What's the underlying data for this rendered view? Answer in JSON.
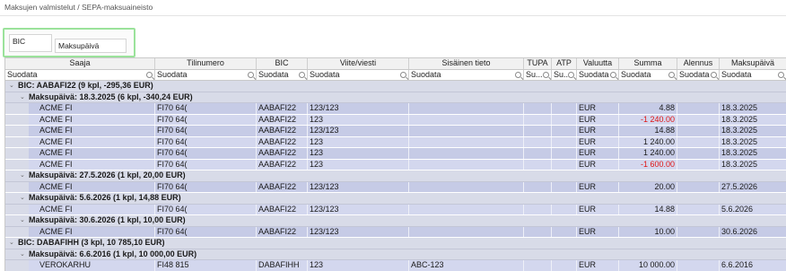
{
  "breadcrumb": "Maksujen valmistelut / SEPA-maksuaineisto",
  "grouping": {
    "chips": [
      "BIC",
      "Maksupäivä"
    ]
  },
  "columns": [
    "Saaja",
    "Tilinumero",
    "BIC",
    "Viite/viesti",
    "Sisäinen tieto",
    "TUPA",
    "ATP",
    "Valuutta",
    "Summa",
    "Alennus",
    "Maksupäivä"
  ],
  "filters": [
    "Suodata",
    "Suodata",
    "Suodata",
    "Suodata",
    "Suodata",
    "Su...",
    "Su...",
    "Suodata",
    "Suodata",
    "Suodata",
    "Suodata"
  ],
  "groups": [
    {
      "label": "BIC: AABAFI22  (9 kpl, -295,36 EUR)",
      "subgroups": [
        {
          "label": "Maksupäivä: 18.3.2025  (6 kpl, -340,24 EUR)",
          "rows": [
            {
              "saaja": "ACME FI",
              "tili": "FI70 64(",
              "bic": "AABAFI22",
              "viite": "123/123",
              "sis": "",
              "tupa": "",
              "atp": "",
              "val": "EUR",
              "summa": "4.88",
              "neg": false,
              "ale": "",
              "pvm": "18.3.2025"
            },
            {
              "saaja": "ACME FI",
              "tili": "FI70 64(",
              "bic": "AABAFI22",
              "viite": "123",
              "sis": "",
              "tupa": "",
              "atp": "",
              "val": "EUR",
              "summa": "-1 240.00",
              "neg": true,
              "ale": "",
              "pvm": "18.3.2025"
            },
            {
              "saaja": "ACME FI",
              "tili": "FI70 64(",
              "bic": "AABAFI22",
              "viite": "123/123",
              "sis": "",
              "tupa": "",
              "atp": "",
              "val": "EUR",
              "summa": "14.88",
              "neg": false,
              "ale": "",
              "pvm": "18.3.2025"
            },
            {
              "saaja": "ACME FI",
              "tili": "FI70 64(",
              "bic": "AABAFI22",
              "viite": "123",
              "sis": "",
              "tupa": "",
              "atp": "",
              "val": "EUR",
              "summa": "1 240.00",
              "neg": false,
              "ale": "",
              "pvm": "18.3.2025"
            },
            {
              "saaja": "ACME FI",
              "tili": "FI70 64(",
              "bic": "AABAFI22",
              "viite": "123",
              "sis": "",
              "tupa": "",
              "atp": "",
              "val": "EUR",
              "summa": "1 240.00",
              "neg": false,
              "ale": "",
              "pvm": "18.3.2025"
            },
            {
              "saaja": "ACME FI",
              "tili": "FI70 64(",
              "bic": "AABAFI22",
              "viite": "123",
              "sis": "",
              "tupa": "",
              "atp": "",
              "val": "EUR",
              "summa": "-1 600.00",
              "neg": true,
              "ale": "",
              "pvm": "18.3.2025"
            }
          ]
        },
        {
          "label": "Maksupäivä: 27.5.2026  (1 kpl, 20,00 EUR)",
          "rows": [
            {
              "saaja": "ACME FI",
              "tili": "FI70 64(",
              "bic": "AABAFI22",
              "viite": "123/123",
              "sis": "",
              "tupa": "",
              "atp": "",
              "val": "EUR",
              "summa": "20.00",
              "neg": false,
              "ale": "",
              "pvm": "27.5.2026"
            }
          ]
        },
        {
          "label": "Maksupäivä: 5.6.2026  (1 kpl, 14,88 EUR)",
          "rows": [
            {
              "saaja": "ACME FI",
              "tili": "FI70 64(",
              "bic": "AABAFI22",
              "viite": "123/123",
              "sis": "",
              "tupa": "",
              "atp": "",
              "val": "EUR",
              "summa": "14.88",
              "neg": false,
              "ale": "",
              "pvm": "5.6.2026"
            }
          ]
        },
        {
          "label": "Maksupäivä: 30.6.2026  (1 kpl, 10,00 EUR)",
          "rows": [
            {
              "saaja": "ACME FI",
              "tili": "FI70 64(",
              "bic": "AABAFI22",
              "viite": "123/123",
              "sis": "",
              "tupa": "",
              "atp": "",
              "val": "EUR",
              "summa": "10.00",
              "neg": false,
              "ale": "",
              "pvm": "30.6.2026"
            }
          ]
        }
      ]
    },
    {
      "label": "BIC: DABAFIHH  (3 kpl, 10 785,10 EUR)",
      "subgroups": [
        {
          "label": "Maksupäivä: 6.6.2016  (1 kpl, 10 000,00 EUR)",
          "rows": [
            {
              "saaja": "VEROKARHU",
              "tili": "FI48 815",
              "bic": "DABAFIHH",
              "viite": "123",
              "sis": "ABC-123",
              "tupa": "",
              "atp": "",
              "val": "EUR",
              "summa": "10 000.00",
              "neg": false,
              "ale": "",
              "pvm": "6.6.2016"
            }
          ]
        }
      ]
    }
  ],
  "colors": {
    "row_bg": "#c6cbe6",
    "group_bg": "#d8dbe8",
    "negative": "#e01515",
    "group_box_border": "#9be29b"
  }
}
